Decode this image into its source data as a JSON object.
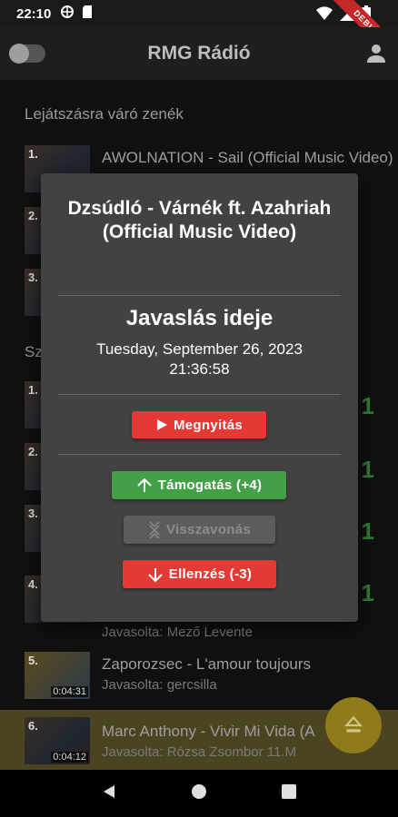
{
  "status_bar": {
    "time": "22:10",
    "ribbon": "DEBUG"
  },
  "app": {
    "title": "RMG Rádió"
  },
  "queue": {
    "heading": "Lejátszásra váró zenék",
    "items": [
      {
        "num": "1.",
        "title": "AWOLNATION - Sail (Official Music Video)"
      },
      {
        "num": "2.",
        "title": ""
      },
      {
        "num": "3.",
        "title": ""
      }
    ]
  },
  "suggestions": {
    "heading_partial": "Sz",
    "items": [
      {
        "num": "1.",
        "score": "1"
      },
      {
        "num": "2.",
        "score": "1"
      },
      {
        "num": "3.",
        "score": "1"
      },
      {
        "num": "4.",
        "score": "1",
        "by": "Javasolta: Mező Levente"
      },
      {
        "num": "5.",
        "title": "Zaporozsec - L'amour toujours",
        "by": "Javasolta: gercsilla",
        "duration": "0:04:31"
      },
      {
        "num": "6.",
        "title": "Marc Anthony - Vivir Mi Vida (A",
        "by": "Javasolta: Rózsa Zsombor 11.M",
        "duration": "0:04:12"
      }
    ]
  },
  "dialog": {
    "song_title": "Dzsúdló - Várnék ft. Azahriah  (Official Music Video)",
    "suggestion_heading": "Javaslás ideje",
    "suggestion_date_line1": "Tuesday, September 26, 2023",
    "suggestion_date_line2": "21:36:58",
    "open_label": "Megnyitás",
    "support_label": "Támogatás (+4)",
    "undo_label": "Visszavonás",
    "oppose_label": "Ellenzés (-3)"
  },
  "colors": {
    "green": "#43a047",
    "red": "#e53935",
    "highlight": "#4a4520",
    "fab": "#8f7a1c"
  }
}
